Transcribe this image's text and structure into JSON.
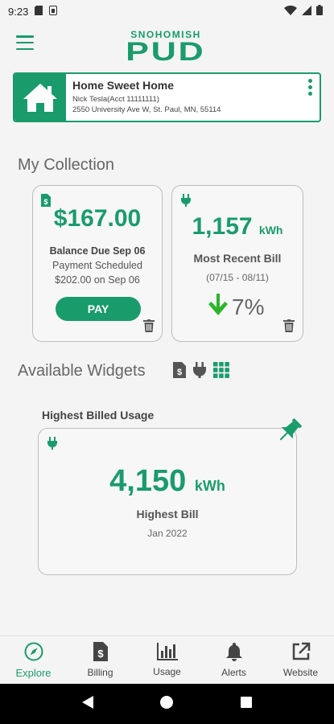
{
  "status_bar": {
    "time": "9:23"
  },
  "header": {
    "logo_top": "SNOHOMISH",
    "logo_main": "PUD"
  },
  "account": {
    "name": "Home Sweet Home",
    "holder": "Nick Tesla(Acct 11111111)",
    "address": "2550 University Ave W, St. Paul, MN, 55114"
  },
  "collection": {
    "title": "My Collection",
    "balance_widget": {
      "amount": "$167.00",
      "due": "Balance Due Sep 06",
      "scheduled": "Payment Scheduled",
      "scheduled_amount": "$202.00 on Sep 06",
      "pay_label": "PAY"
    },
    "usage_widget": {
      "value": "1,157",
      "unit": "kWh",
      "label": "Most Recent Bill",
      "period": "(07/15 - 08/11)",
      "change": "7%"
    }
  },
  "available": {
    "title": "Available Widgets",
    "widget_title": "Highest Billed Usage",
    "widget": {
      "value": "4,150",
      "unit": "kWh",
      "label": "Highest Bill",
      "date": "Jan 2022"
    }
  },
  "bottom_nav": {
    "explore": "Explore",
    "billing": "Billing",
    "usage": "Usage",
    "alerts": "Alerts",
    "website": "Website"
  },
  "colors": {
    "brand": "#1a9b6c"
  }
}
